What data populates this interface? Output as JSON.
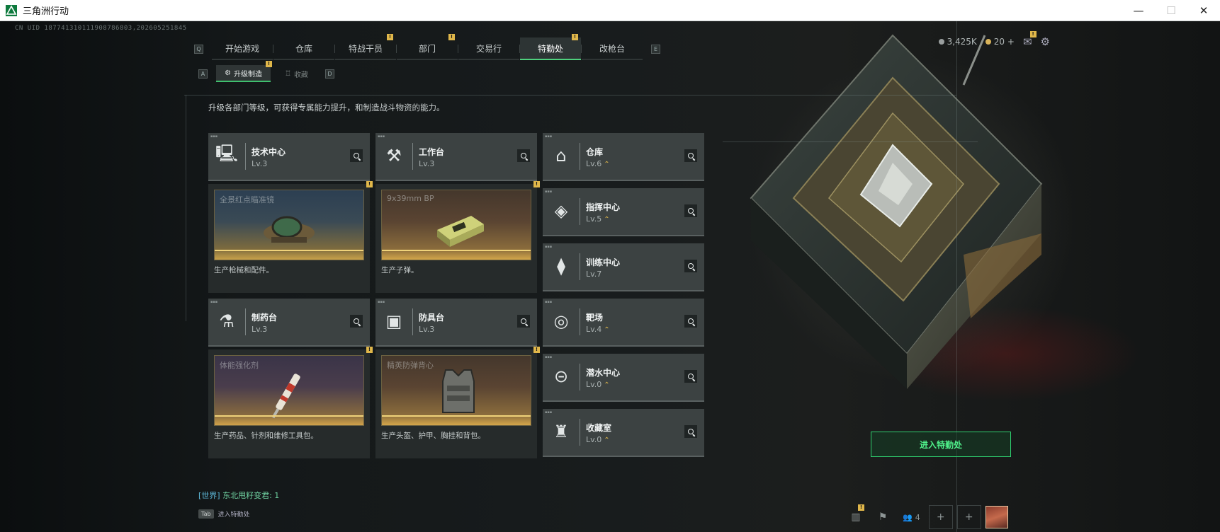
{
  "window": {
    "title": "三角洲行动",
    "min": "—",
    "max": "☐",
    "close": "✕"
  },
  "uid": "CN UID 187741310111908786803,202605251845",
  "tabs": [
    {
      "label": "开始游戏",
      "badge": ""
    },
    {
      "label": "仓库",
      "badge": ""
    },
    {
      "label": "特战干员",
      "badge": "!"
    },
    {
      "label": "部门",
      "badge": "!"
    },
    {
      "label": "交易行",
      "badge": ""
    },
    {
      "label": "特勤处",
      "badge": "!"
    },
    {
      "label": "改枪台",
      "badge": ""
    }
  ],
  "keys": {
    "prev": "Q",
    "next": "E",
    "sub_prev": "A",
    "sub_next": "D"
  },
  "subtabs": [
    {
      "label": "升级制造",
      "badge": "!"
    },
    {
      "label": "收藏",
      "badge": ""
    }
  ],
  "currency": {
    "silver": "3,425K",
    "gold": "20",
    "gold_add": "+"
  },
  "hud_badges": {
    "mail": "!"
  },
  "description": "升级各部门等级，可获得专属能力提升，和制造战斗物资的能力。",
  "departments": [
    {
      "name": "技术中心",
      "level": "Lv.3",
      "upgrade": ""
    },
    {
      "name": "工作台",
      "level": "Lv.3",
      "upgrade": ""
    },
    {
      "name": "仓库",
      "level": "Lv.6",
      "upgrade": "⌃"
    },
    {
      "name": "指挥中心",
      "level": "Lv.5",
      "upgrade": "⌃"
    },
    {
      "name": "训练中心",
      "level": "Lv.7",
      "upgrade": ""
    },
    {
      "name": "制药台",
      "level": "Lv.3",
      "upgrade": ""
    },
    {
      "name": "防具台",
      "level": "Lv.3",
      "upgrade": ""
    },
    {
      "name": "靶场",
      "level": "Lv.4",
      "upgrade": "⌃"
    },
    {
      "name": "潜水中心",
      "level": "Lv.0",
      "upgrade": "⌃"
    },
    {
      "name": "收藏室",
      "level": "Lv.0",
      "upgrade": "⌃"
    }
  ],
  "crafts": [
    {
      "item": "全景红点瞄准镜",
      "desc": "生产枪械和配件。",
      "badge": "!"
    },
    {
      "item": "9x39mm BP",
      "desc": "生产子弹。",
      "badge": "!"
    },
    {
      "item": "体能强化剂",
      "desc": "生产药品、针剂和维修工具包。",
      "badge": "!"
    },
    {
      "item": "精英防弹背心",
      "desc": "生产头盔、护甲、胸挂和背包。",
      "badge": "!"
    }
  ],
  "enter_button": "进入特勤处",
  "chat": {
    "channel": "[世界]",
    "message": "东北甩籽变君: 1"
  },
  "tab_hint": {
    "key": "Tab",
    "label": "进入特勤处"
  },
  "bottom": {
    "stats_badge": "!",
    "squad_count": "4",
    "add1": "+",
    "add2": "+"
  }
}
